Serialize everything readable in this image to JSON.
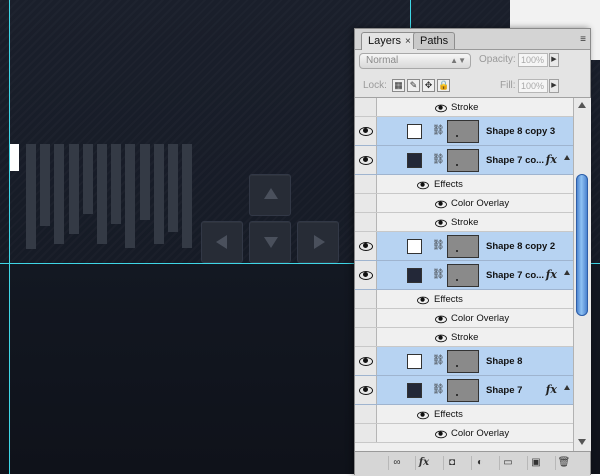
{
  "colors": {
    "canvas_bg": "#161b26",
    "guide": "#3fd6e6",
    "bar": "#343a45",
    "layer_selected": "#b7d3f2",
    "shape_dark": "#232838"
  },
  "panel": {
    "tabs": [
      {
        "label": "Layers",
        "active": true,
        "close": "×"
      },
      {
        "label": "Paths",
        "active": false
      }
    ],
    "menu_icon": "≡",
    "blend_mode": "Normal",
    "opacity_label": "Opacity:",
    "opacity_value": "100%",
    "lock_label": "Lock:",
    "fill_label": "Fill:",
    "fill_value": "100%",
    "lock_icons": [
      "lock-transparent-icon",
      "lock-image-icon",
      "lock-position-icon",
      "lock-all-icon"
    ],
    "layers": [
      {
        "kind": "effect",
        "name": "Stroke",
        "visible": true
      },
      {
        "kind": "shape",
        "name": "Shape 8 copy 3",
        "swatch": "white",
        "fx": false,
        "visible": true
      },
      {
        "kind": "shape",
        "name": "Shape 7 co...",
        "swatch": "dark",
        "fx": true,
        "visible": true
      },
      {
        "kind": "effects-header",
        "name": "Effects",
        "visible": true
      },
      {
        "kind": "effect",
        "name": "Color Overlay",
        "visible": true
      },
      {
        "kind": "effect",
        "name": "Stroke",
        "visible": true
      },
      {
        "kind": "shape",
        "name": "Shape 8 copy 2",
        "swatch": "white",
        "fx": false,
        "visible": true
      },
      {
        "kind": "shape",
        "name": "Shape 7 co...",
        "swatch": "dark",
        "fx": true,
        "visible": true
      },
      {
        "kind": "effects-header",
        "name": "Effects",
        "visible": true
      },
      {
        "kind": "effect",
        "name": "Color Overlay",
        "visible": true
      },
      {
        "kind": "effect",
        "name": "Stroke",
        "visible": true
      },
      {
        "kind": "shape",
        "name": "Shape 8",
        "swatch": "white",
        "fx": false,
        "visible": true
      },
      {
        "kind": "shape",
        "name": "Shape 7",
        "swatch": "dark",
        "fx": true,
        "visible": true
      },
      {
        "kind": "effects-header",
        "name": "Effects",
        "visible": true
      },
      {
        "kind": "effect",
        "name": "Color Overlay",
        "visible": true
      }
    ],
    "fx_label": "fx",
    "bottom_buttons": [
      {
        "name": "link-layers-icon",
        "glyph": "∞"
      },
      {
        "name": "add-style-icon",
        "glyph": "fx"
      },
      {
        "name": "add-mask-icon",
        "glyph": "◘"
      },
      {
        "name": "adjustment-layer-icon",
        "glyph": "◐"
      },
      {
        "name": "new-group-icon",
        "glyph": "▭"
      },
      {
        "name": "new-layer-icon",
        "glyph": "▣"
      },
      {
        "name": "delete-layer-icon",
        "glyph": "🗑"
      }
    ]
  }
}
